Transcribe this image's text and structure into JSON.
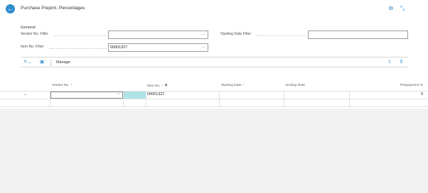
{
  "header": {
    "title": "Purchase Prepmt. Percentages",
    "icons": [
      "back-arrow-icon",
      "open-new-window-icon",
      "collapse-icon"
    ]
  },
  "general": {
    "section_title": "General",
    "vendor_filter_label": "Vendor No. Filter",
    "vendor_filter_value": "",
    "item_filter_label": "Item No. Filter",
    "item_filter_value": "00001327",
    "starting_date_filter_label": "Starting Date Filter",
    "starting_date_filter_value": "",
    "lookup_glyph": "…"
  },
  "actionbar": {
    "manage_label": "Manage",
    "icons": [
      "new-icon",
      "edit-list-icon",
      "share-icon",
      "filter-icon"
    ]
  },
  "table": {
    "columns": [
      {
        "label": "Vendor No. ↑"
      },
      {
        "label": "Item No. ↑"
      },
      {
        "label": "Starting Date ↑"
      },
      {
        "label": "Ending Date"
      },
      {
        "label": "Prepayment %"
      }
    ],
    "rows": [
      {
        "indicator": "→",
        "vendor_no": "",
        "item_no": "00001327",
        "starting_date": "",
        "ending_date": "",
        "prepayment_pct": "0"
      },
      {
        "indicator": "",
        "vendor_no": "",
        "item_no": "",
        "starting_date": "",
        "ending_date": "",
        "prepayment_pct": ""
      }
    ]
  },
  "colors": {
    "accent": "#2f8dcd",
    "selected_cell": "#aee3e6",
    "background": "#f1f1f1"
  }
}
